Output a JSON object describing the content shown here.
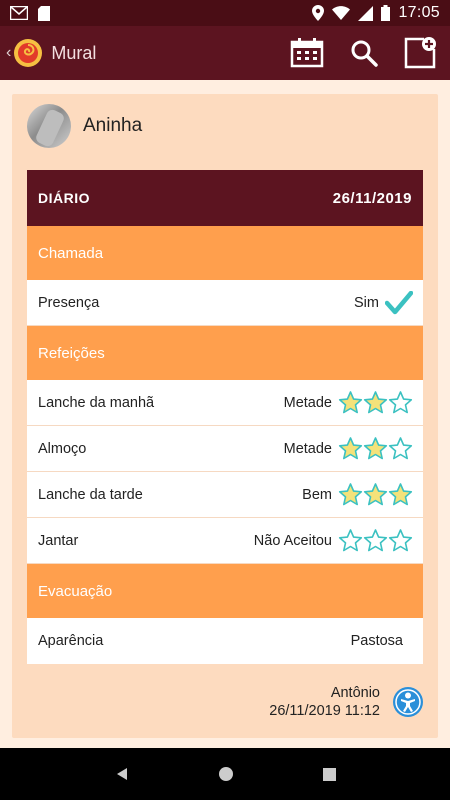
{
  "status_bar": {
    "time": "17:05"
  },
  "app_bar": {
    "back_label": "‹",
    "title": "Mural"
  },
  "post": {
    "author": "Aninha",
    "diary": {
      "title": "DIÁRIO",
      "date": "26/11/2019",
      "sections": [
        {
          "label": "Chamada",
          "rows": [
            {
              "label": "Presença",
              "value": "Sim",
              "check": true
            }
          ]
        },
        {
          "label": "Refeições",
          "rows": [
            {
              "label": "Lanche da manhã",
              "value": "Metade",
              "rating": 2,
              "max": 3
            },
            {
              "label": "Almoço",
              "value": "Metade",
              "rating": 2,
              "max": 3
            },
            {
              "label": "Lanche da tarde",
              "value": "Bem",
              "rating": 3,
              "max": 3
            },
            {
              "label": "Jantar",
              "value": "Não Aceitou",
              "rating": 0,
              "max": 3
            }
          ]
        },
        {
          "label": "Evacuação",
          "rows": [
            {
              "label": "Aparência",
              "value": "Pastosa"
            }
          ]
        }
      ]
    },
    "footer": {
      "teacher": "Antônio",
      "timestamp": "26/11/2019 11:12"
    }
  },
  "colors": {
    "primary": "#5c1420",
    "section": "#ff9f4d",
    "card_bg": "#fddbbf",
    "star_filled": "#f4e27a",
    "star_outline": "#3bc1c1",
    "check": "#3bc1c1"
  },
  "icons": {
    "status_left": [
      "gmail-icon",
      "sd-card-icon"
    ],
    "status_right": [
      "location-icon",
      "wifi-icon",
      "signal-icon",
      "battery-icon"
    ],
    "app_actions": [
      "calendar-icon",
      "search-icon",
      "add-post-icon"
    ],
    "nav": [
      "back-nav-icon",
      "home-nav-icon",
      "recents-nav-icon"
    ]
  }
}
